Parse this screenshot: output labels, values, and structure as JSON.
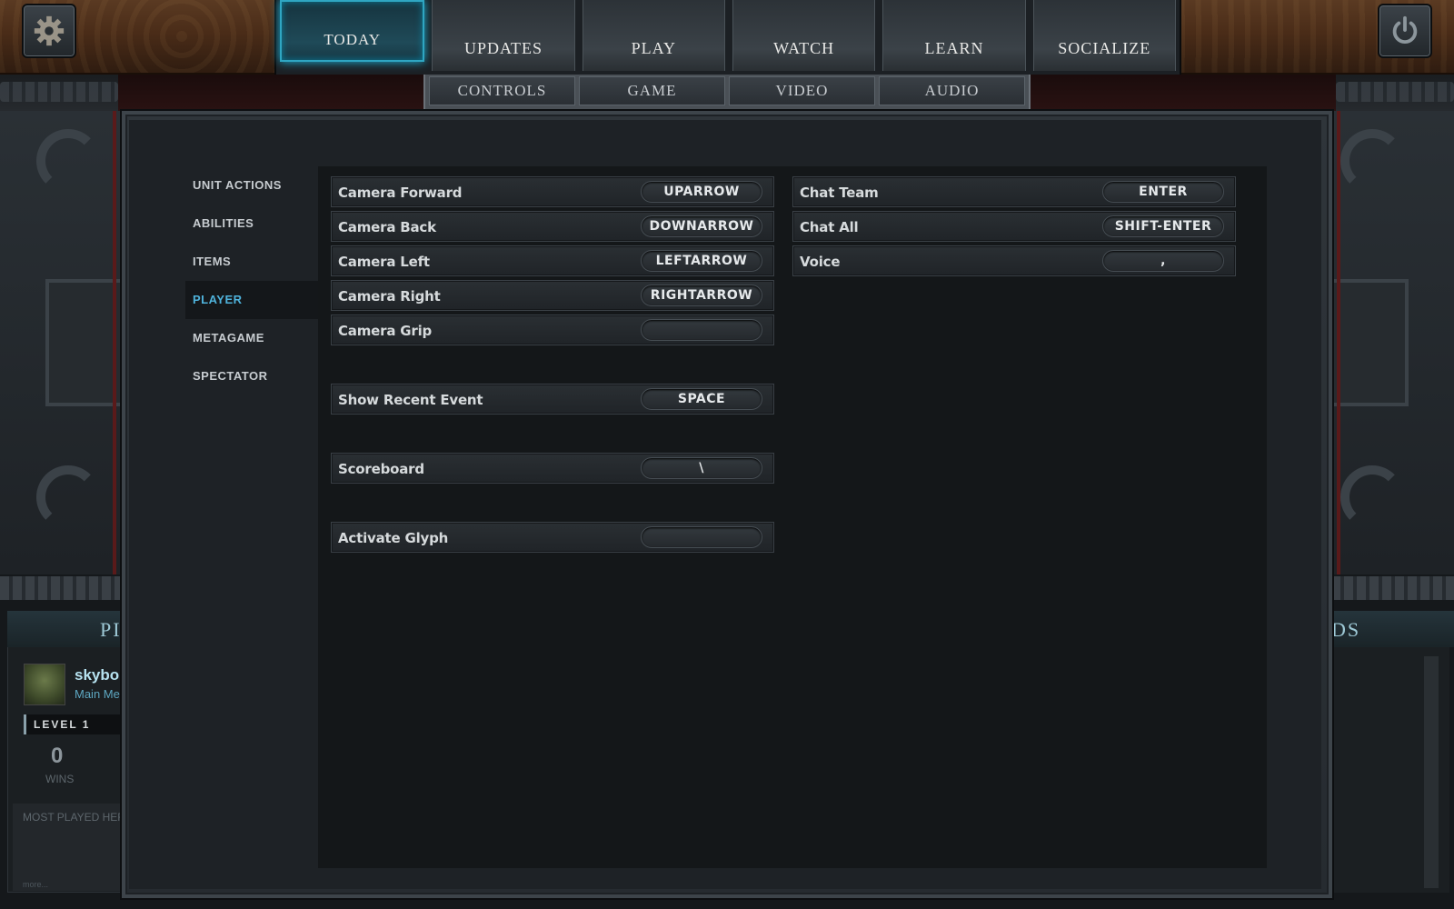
{
  "top_nav": {
    "tabs": [
      {
        "label": "TODAY",
        "active": true
      },
      {
        "label": "UPDATES",
        "active": false
      },
      {
        "label": "PLAY",
        "active": false
      },
      {
        "label": "WATCH",
        "active": false
      },
      {
        "label": "LEARN",
        "active": false
      },
      {
        "label": "SOCIALIZE",
        "active": false
      }
    ],
    "settings_icon": "gear-icon",
    "power_icon": "power-icon"
  },
  "sub_nav": {
    "tabs": [
      {
        "label": "CONTROLS"
      },
      {
        "label": "GAME"
      },
      {
        "label": "VIDEO"
      },
      {
        "label": "AUDIO"
      }
    ]
  },
  "categories": [
    {
      "label": "UNIT ACTIONS",
      "active": false
    },
    {
      "label": "ABILITIES",
      "active": false
    },
    {
      "label": "ITEMS",
      "active": false
    },
    {
      "label": "PLAYER",
      "active": true
    },
    {
      "label": "METAGAME",
      "active": false
    },
    {
      "label": "SPECTATOR",
      "active": false
    }
  ],
  "bindings_left": [
    {
      "label": "Camera Forward",
      "key": "UPARROW"
    },
    {
      "label": "Camera Back",
      "key": "DOWNARROW"
    },
    {
      "label": "Camera Left",
      "key": "LEFTARROW"
    },
    {
      "label": "Camera Right",
      "key": "RIGHTARROW"
    },
    {
      "label": "Camera Grip",
      "key": ""
    },
    {
      "label": "Show Recent Event",
      "key": "SPACE"
    },
    {
      "label": "Scoreboard",
      "key": "\\"
    },
    {
      "label": "Activate Glyph",
      "key": ""
    }
  ],
  "bindings_right": [
    {
      "label": "Chat Team",
      "key": "ENTER"
    },
    {
      "label": "Chat All",
      "key": "SHIFT-ENTER"
    },
    {
      "label": "Voice",
      "key": ","
    }
  ],
  "background": {
    "left_header": "PI",
    "right_header": "DS",
    "profile_name": "skybo",
    "profile_sub": "Main Me",
    "level": "LEVEL 1",
    "wins_value": "0",
    "wins_label": "WINS",
    "most_played": "MOST PLAYED HER",
    "more": "more..."
  },
  "colors": {
    "accent": "#4fb3dc",
    "active_tab_glow": "#1bb2d8"
  }
}
